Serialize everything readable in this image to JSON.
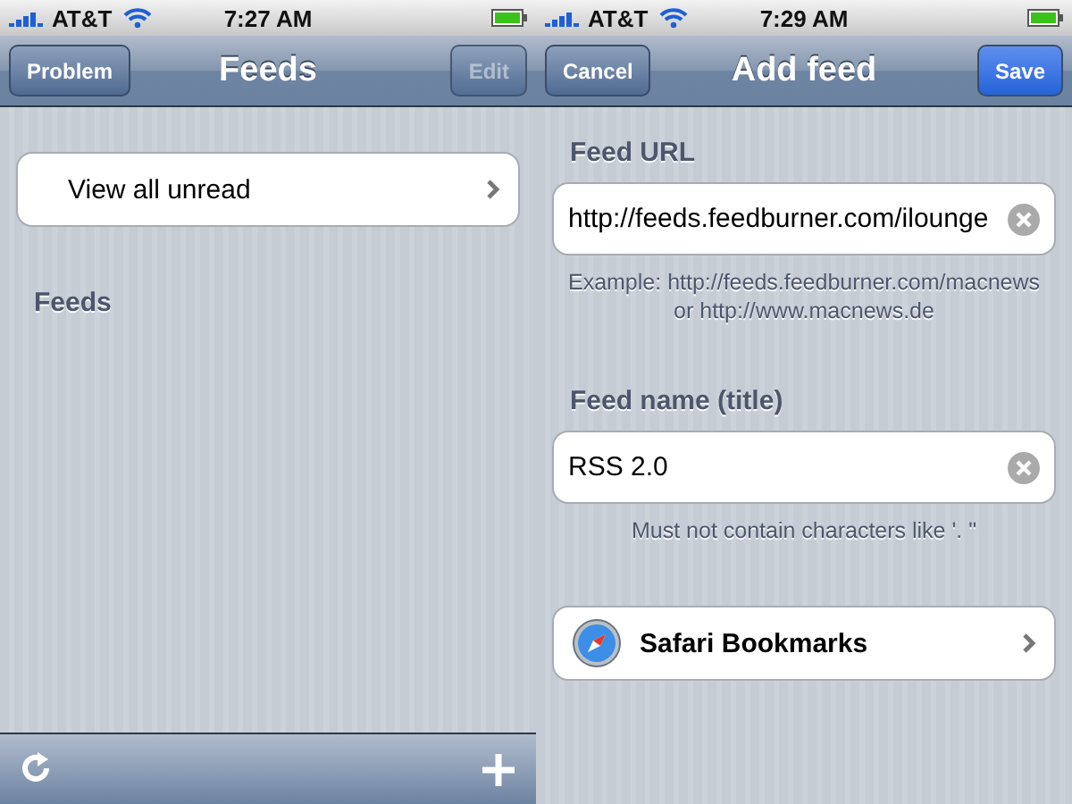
{
  "feeds_screen": {
    "status_bar": {
      "carrier": "AT&T",
      "time": "7:27 AM"
    },
    "nav_bar": {
      "left_button": {
        "label": "Problem",
        "kind": "plain",
        "disabled": false
      },
      "title": "Feeds",
      "right_button": {
        "label": "Edit",
        "kind": "plain",
        "disabled": true
      }
    },
    "rows": [
      {
        "label": "View all unread"
      }
    ],
    "section_header": "Feeds",
    "toolbar": {
      "items": [
        {
          "kind": "refresh"
        },
        {
          "kind": "add"
        }
      ]
    }
  },
  "add_feed_screen": {
    "status_bar": {
      "carrier": "AT&T",
      "time": "7:29 AM"
    },
    "nav_bar": {
      "left_button": {
        "label": "Cancel",
        "kind": "plain",
        "disabled": false
      },
      "title": "Add feed",
      "right_button": {
        "label": "Save",
        "kind": "done",
        "disabled": false
      }
    },
    "fields": [
      {
        "label": "Feed URL",
        "value": "http://feeds.feedburner.com/ilounge",
        "hint_lines": [
          "Example: http://feeds.feedburner.com/macnews",
          "or http://www.macnews.de"
        ]
      },
      {
        "label": "Feed name (title)",
        "value": "RSS 2.0",
        "hint_lines": [
          "Must not contain characters like '. \""
        ]
      }
    ],
    "bookmarks_row": {
      "label": "Safari Bookmarks"
    }
  }
}
